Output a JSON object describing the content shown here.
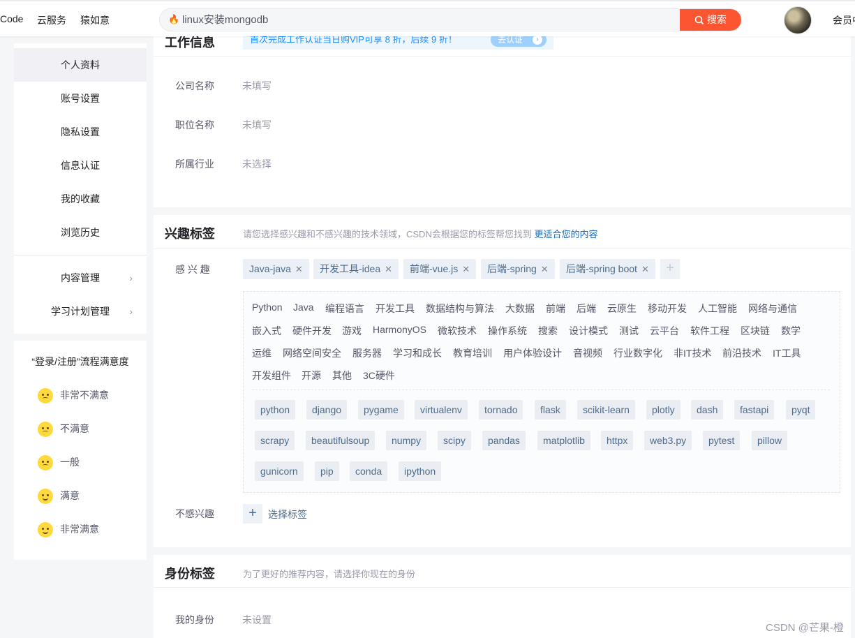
{
  "topbar": {
    "nav": [
      "Code",
      "云服务",
      "猿如意"
    ],
    "search_query": "linux安装mongodb",
    "search_button": "搜索",
    "member_link": "会员中"
  },
  "sidebar": {
    "items": [
      {
        "label": "个人资料",
        "active": true
      },
      {
        "label": "账号设置"
      },
      {
        "label": "隐私设置"
      },
      {
        "label": "信息认证"
      },
      {
        "label": "我的收藏"
      },
      {
        "label": "浏览历史"
      },
      {
        "label": "内容管理",
        "chevron": true
      },
      {
        "label": "学习计划管理",
        "chevron": true
      }
    ]
  },
  "survey": {
    "title": "“登录/注册”流程满意度",
    "options": [
      "非常不满意",
      "不满意",
      "一般",
      "满意",
      "非常满意"
    ]
  },
  "work_info": {
    "title": "工作信息",
    "promo_text": "首次完成工作认证当日购VIP可享 8 折，后续 9 折！",
    "promo_button": "去认证",
    "fields": [
      {
        "label": "公司名称",
        "value": "未填写"
      },
      {
        "label": "职位名称",
        "value": "未填写"
      },
      {
        "label": "所属行业",
        "value": "未选择"
      }
    ]
  },
  "interest": {
    "title": "兴趣标签",
    "desc": "请您选择感兴趣和不感兴趣的技术领域，CSDN会根据您的标签帮您找到 ",
    "desc_link": "更适合您的内容",
    "interested_label": "感 兴 趣",
    "selected": [
      "Java-java",
      "开发工具-idea",
      "前端-vue.js",
      "后端-spring",
      "后端-spring boot"
    ],
    "categories": [
      [
        "Python",
        "Java",
        "编程语言",
        "开发工具",
        "数据结构与算法",
        "大数据",
        "前端",
        "后端",
        "云原生",
        "移动开发",
        "人工智能",
        "网络与通信"
      ],
      [
        "嵌入式",
        "硬件开发",
        "游戏",
        "HarmonyOS",
        "微软技术",
        "操作系统",
        "搜索",
        "设计模式",
        "测试",
        "云平台",
        "软件工程",
        "区块链",
        "数学"
      ],
      [
        "运维",
        "网络空间安全",
        "服务器",
        "学习和成长",
        "教育培训",
        "用户体验设计",
        "音视频",
        "行业数字化",
        "非IT技术",
        "前沿技术",
        "IT工具"
      ],
      [
        "开发组件",
        "开源",
        "其他",
        "3C硬件"
      ]
    ],
    "subtags": [
      [
        "python",
        "django",
        "pygame",
        "virtualenv",
        "tornado",
        "flask",
        "scikit-learn",
        "plotly",
        "dash",
        "fastapi",
        "pyqt"
      ],
      [
        "scrapy",
        "beautifulsoup",
        "numpy",
        "scipy",
        "pandas",
        "matplotlib",
        "httpx",
        "web3.py",
        "pytest",
        "pillow"
      ],
      [
        "gunicorn",
        "pip",
        "conda",
        "ipython"
      ]
    ],
    "not_interested_label": "不感兴趣",
    "choose_label": "选择标签"
  },
  "identity": {
    "title": "身份标签",
    "desc": "为了更好的推荐内容，请选择你现在的身份",
    "field_label": "我的身份",
    "field_value": "未设置"
  },
  "watermark": "CSDN @芒果-橙"
}
